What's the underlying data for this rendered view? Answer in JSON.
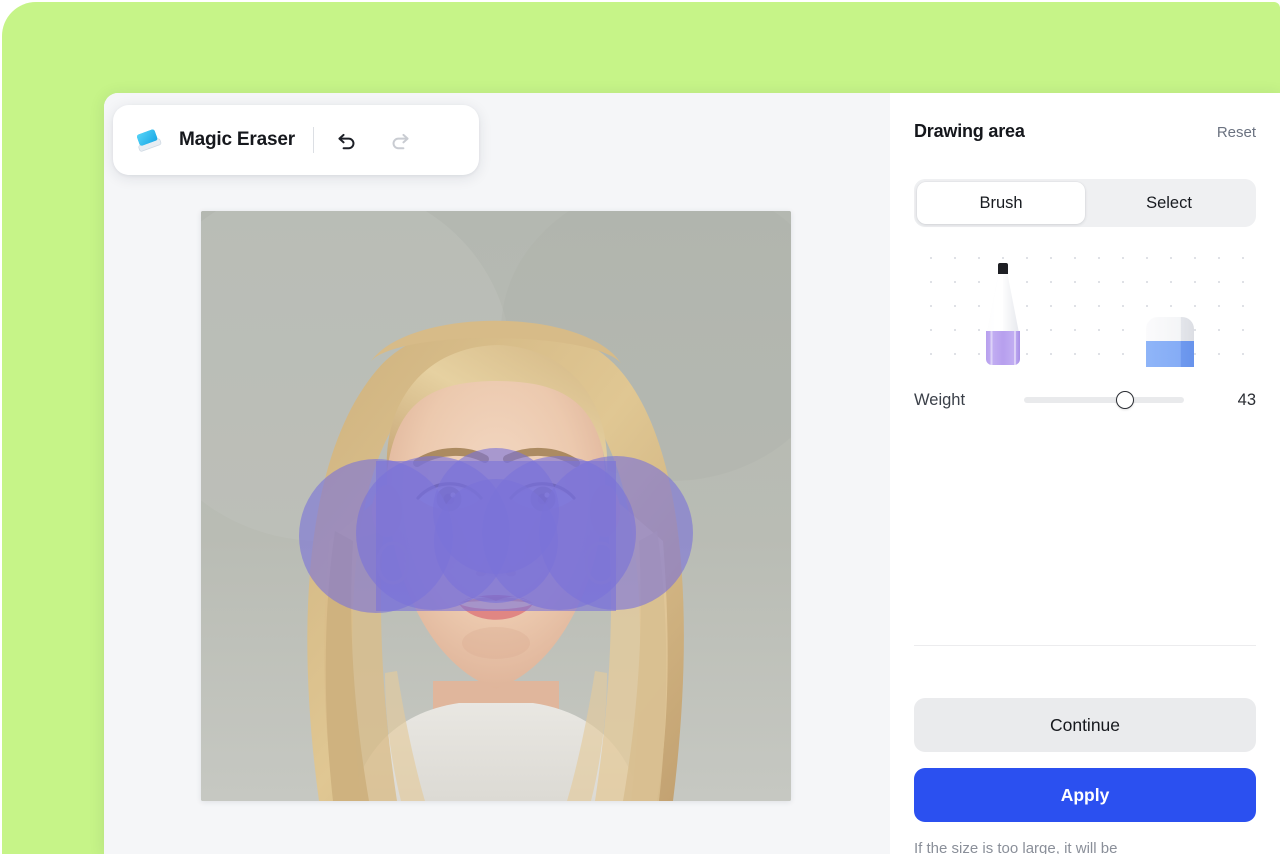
{
  "theme": {
    "background_green": "#C6F488",
    "panel_background": "#F5F6F8",
    "accent_blue": "#2B50F0",
    "mask_purple": "#7B72D8",
    "pen_purple": "#B39DEB",
    "eraser_blue": "#7CA7F5",
    "logo_cyan": "#29BDEE"
  },
  "toolbar": {
    "logo_icon": "eraser-logo-icon",
    "app_title": "Magic Eraser",
    "undo_icon": "undo-arrow-icon",
    "undo_label": "Undo",
    "redo_icon": "redo-arrow-icon",
    "redo_label": "Redo",
    "redo_disabled": true
  },
  "canvas": {
    "name": "portrait-photo-canvas",
    "alt": "Portrait photo of a blonde young woman with a purple brush mask over her nose and cheeks",
    "mask_color": "#7B72D8",
    "mask_opacity": 0.62
  },
  "sidebar": {
    "title": "Drawing area",
    "reset_label": "Reset",
    "modes": [
      {
        "label": "Brush",
        "active": true
      },
      {
        "label": "Select",
        "active": false
      }
    ],
    "tools": [
      {
        "name": "pen-tool",
        "icon": "stylus-pen-icon",
        "selected": true
      },
      {
        "name": "eraser-tool",
        "icon": "eraser-icon",
        "selected": false
      }
    ],
    "weight": {
      "label": "Weight",
      "value": "43",
      "min": 0,
      "max": 100,
      "percent": 63
    },
    "continue_label": "Continue",
    "apply_label": "Apply",
    "hint_text": "If the size is too large, it will be"
  }
}
